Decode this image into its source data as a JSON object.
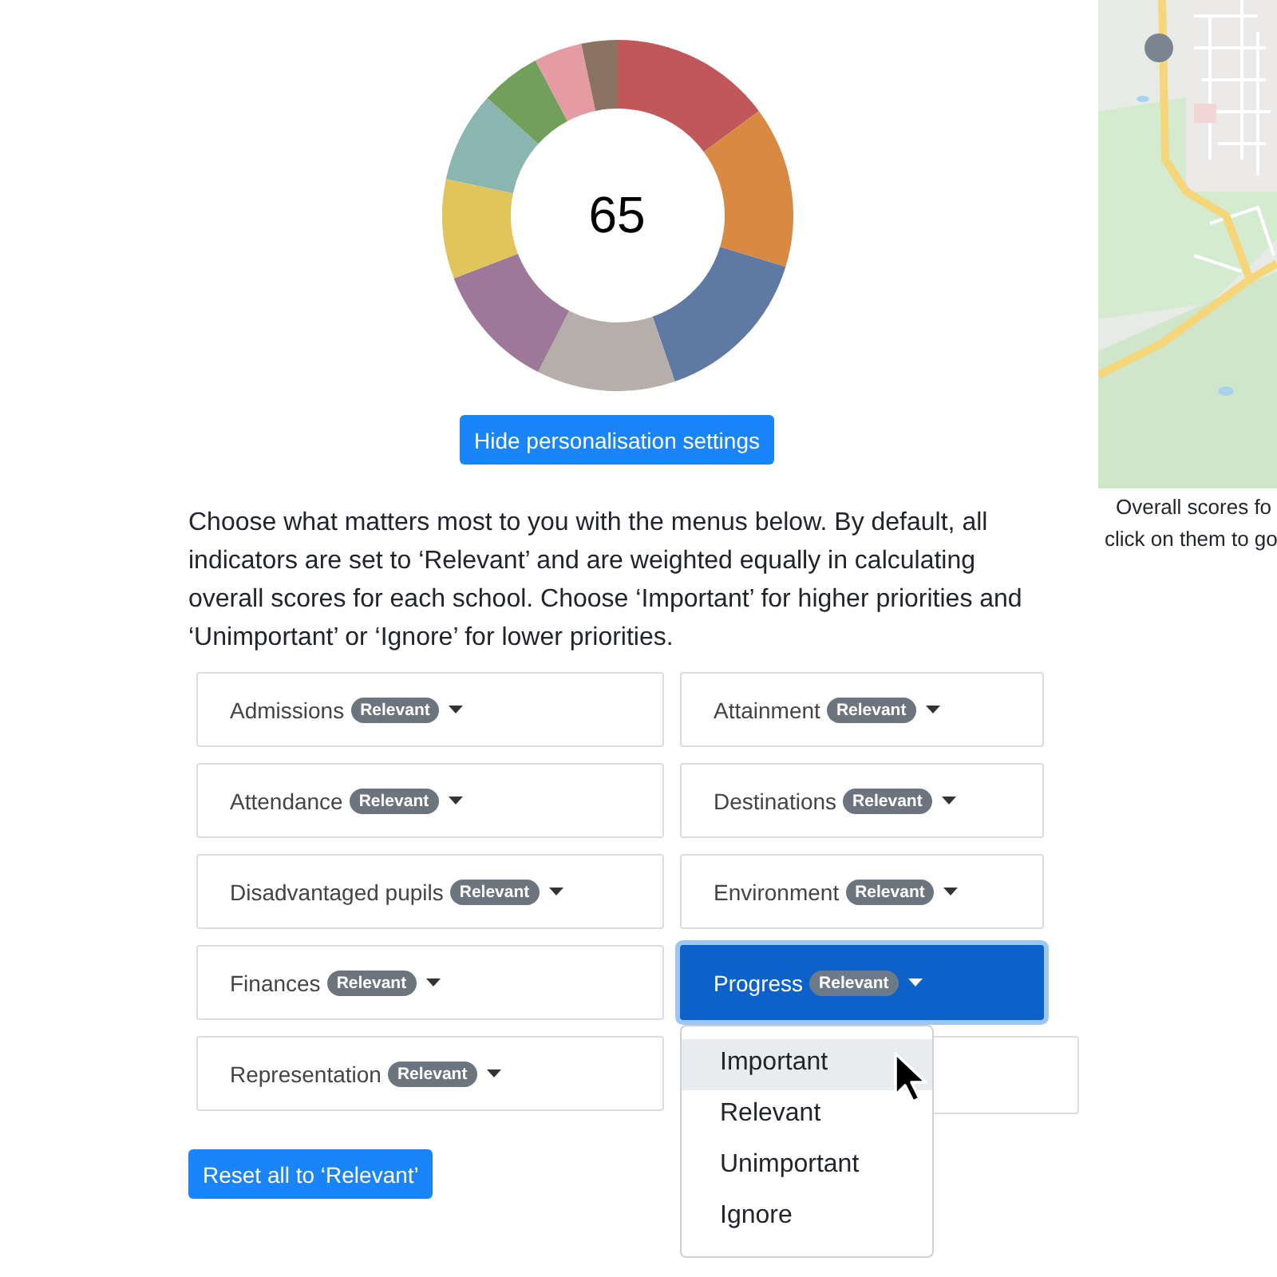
{
  "score": "65",
  "toggle_button": "Hide personalisation settings",
  "intro": "Choose what matters most to you with the menus below. By default, all indicators are set to ‘Relevant’ and are weighted equally in calculating overall scores for each school. Choose ‘Important’ for higher priorities and ‘Unimportant’ or ‘Ignore’ for lower priorities.",
  "indicators": [
    {
      "label": "Admissions",
      "badge": "Relevant",
      "open": false
    },
    {
      "label": "Attainment",
      "badge": "Relevant",
      "open": false
    },
    {
      "label": "Attendance",
      "badge": "Relevant",
      "open": false
    },
    {
      "label": "Destinations",
      "badge": "Relevant",
      "open": false
    },
    {
      "label": "Disadvantaged pupils",
      "badge": "Relevant",
      "open": false
    },
    {
      "label": "Environment",
      "badge": "Relevant",
      "open": false
    },
    {
      "label": "Finances",
      "badge": "Relevant",
      "open": false
    },
    {
      "label": "Progress",
      "badge": "Relevant",
      "open": true
    },
    {
      "label": "Representation",
      "badge": "Relevant",
      "open": false
    }
  ],
  "menu_items": [
    {
      "label": "Important",
      "hovered": true
    },
    {
      "label": "Relevant",
      "hovered": false
    },
    {
      "label": "Unimportant",
      "hovered": false
    },
    {
      "label": "Ignore",
      "hovered": false
    }
  ],
  "reset_button": "Reset all to ‘Relevant’",
  "map": {
    "kind": "picture",
    "caption_lines": [
      "Overall scores fo",
      "click on them to go"
    ]
  }
}
